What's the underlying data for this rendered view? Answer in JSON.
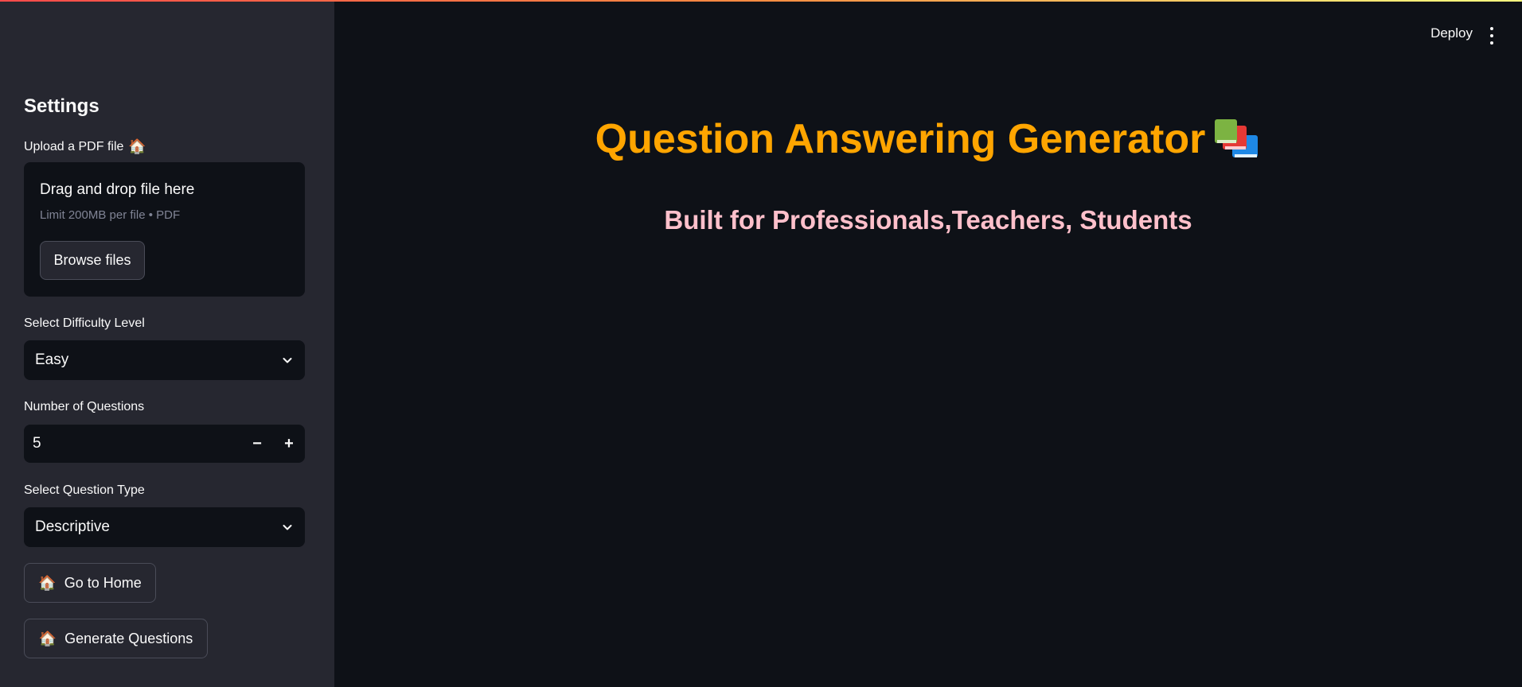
{
  "header": {
    "deploy_label": "Deploy",
    "menu_icon": "kebab-menu-icon"
  },
  "sidebar": {
    "heading": "Settings",
    "upload": {
      "label": "Upload a PDF file",
      "label_icon": "🏠",
      "dropzone_title": "Drag and drop file here",
      "dropzone_limit": "Limit 200MB per file • PDF",
      "browse_label": "Browse files"
    },
    "difficulty": {
      "label": "Select Difficulty Level",
      "selected": "Easy"
    },
    "num_questions": {
      "label": "Number of Questions",
      "value": "5",
      "minus": "−",
      "plus": "+"
    },
    "question_type": {
      "label": "Select Question Type",
      "selected": "Descriptive"
    },
    "home_button": {
      "icon": "🏠",
      "label": "Go to Home"
    },
    "generate_button": {
      "icon": "🏠",
      "label": "Generate Questions"
    }
  },
  "main": {
    "title": "Question Answering Generator",
    "title_icon": "books-icon",
    "subtitle": "Built for Professionals,Teachers, Students"
  },
  "colors": {
    "title": "#ffa500",
    "subtitle": "#ffc0cb",
    "sidebar_bg": "#262730",
    "main_bg": "#0e1117"
  }
}
